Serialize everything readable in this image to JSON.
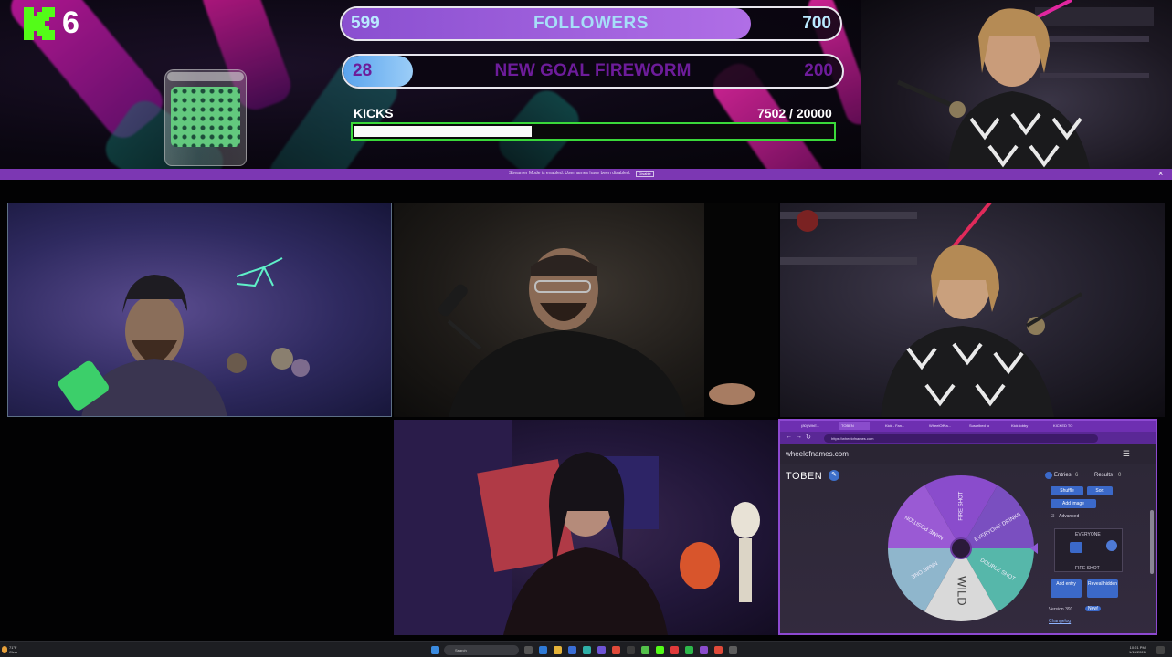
{
  "overlay": {
    "kick_count": "6",
    "followers": {
      "current": "599",
      "label": "FOLLOWERS",
      "goal": "700",
      "progress": 0.82
    },
    "new_goal": {
      "current": "28",
      "label": "NEW GOAL FIREWORM",
      "goal": "200",
      "progress": 0.14
    },
    "kicks": {
      "label": "KICKS",
      "count": "7502 / 20000",
      "progress": 0.375
    }
  },
  "streamer_banner": {
    "text": "Streamer Mode is enabled. Usernames have been disabled.",
    "button_label": "Disable",
    "close_label": "×"
  },
  "browser": {
    "tabs": [
      "(80) WhE...",
      "TOBEN",
      "Kick - Fan...",
      "WheelOfNa...",
      "Suscribed to",
      "Kick lobby",
      "KICKED TO"
    ],
    "url": "https://wheelofnames.com",
    "site_name": "wheelofnames.com",
    "wheel_title": "TOBEN",
    "wheel_segments": [
      "FIRE SHOT",
      "EVERYONE DRINKS",
      "DOUBLE SHOT",
      "WILD",
      "NAME ONE",
      "NAME POSITION"
    ],
    "sidebar": {
      "tab_entries": "Entries",
      "entries_count": "6",
      "tab_results": "Results",
      "results_count": "0",
      "shuffle_label": "Shuffle",
      "sort_label": "Sort",
      "add_image_label": "Add image",
      "advanced_label": "Advanced",
      "entry_1": "EVERYONE",
      "entry_2": "FIRE SHOT",
      "add_entry_label": "Add entry",
      "reveal_hidden_label": "Reveal hidden",
      "version_label": "Version 391",
      "new_badge": "New!",
      "changelog_label": "Changelog"
    }
  },
  "taskbar": {
    "weather_temp": "71°F",
    "weather_desc": "Clear",
    "search_placeholder": "Search",
    "time": "10:21 PM",
    "date": "1/13/2026"
  },
  "colors": {
    "accent_purple": "#7c37b3",
    "kick_green": "#53fc18",
    "followers_fill": "#8a4fd0",
    "goal_fill": "#5aa4ee"
  }
}
